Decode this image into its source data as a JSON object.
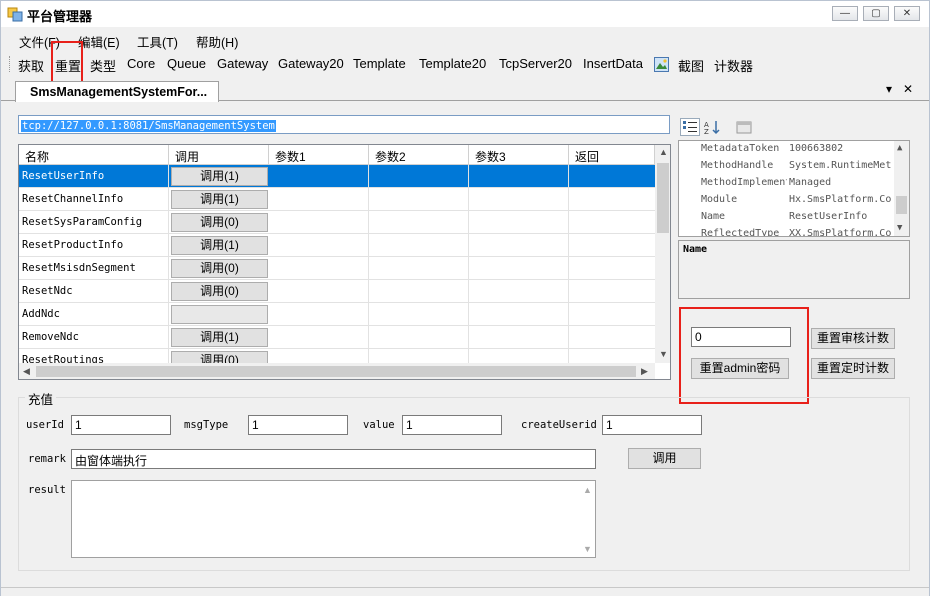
{
  "window": {
    "title": "平台管理器",
    "controls": {
      "minimize": "—",
      "maximize": "▢",
      "close": "✕"
    }
  },
  "menu": [
    "文件(F)",
    "编辑(E)",
    "工具(T)",
    "帮助(H)"
  ],
  "toolbar": [
    "获取",
    "重置",
    "类型",
    "Core",
    "Queue",
    "Gateway",
    "Gateway20",
    "Template",
    "Template20",
    "TcpServer20",
    "InsertData",
    "截图",
    "计数器"
  ],
  "tab": {
    "label": "SmsManagementSystemFor...",
    "dropdown": "▾",
    "close": "✕"
  },
  "url": "tcp://127.0.0.1:8081/SmsManagementSystem",
  "grid": {
    "columns": [
      "名称",
      "调用",
      "参数1",
      "参数2",
      "参数3",
      "返回"
    ],
    "rows": [
      {
        "name": "ResetUserInfo",
        "call": "调用(1)"
      },
      {
        "name": "ResetChannelInfo",
        "call": "调用(1)"
      },
      {
        "name": "ResetSysParamConfig",
        "call": "调用(0)"
      },
      {
        "name": "ResetProductInfo",
        "call": "调用(1)"
      },
      {
        "name": "ResetMsisdnSegment",
        "call": "调用(0)"
      },
      {
        "name": "ResetNdc",
        "call": "调用(0)"
      },
      {
        "name": "AddNdc",
        "call": ""
      },
      {
        "name": "RemoveNdc",
        "call": "调用(1)"
      },
      {
        "name": "ResetRoutings",
        "call": "调用(0)"
      }
    ],
    "selected_index": 0
  },
  "properties": {
    "rows": [
      {
        "key": "MetadataToken",
        "value": "100663802"
      },
      {
        "key": "MethodHandle",
        "value": "System.RuntimeMet"
      },
      {
        "key": "MethodImplementation",
        "value": "Managed"
      },
      {
        "key": "Module",
        "value": "Hx.SmsPlatform.Co"
      },
      {
        "key": "Name",
        "value": "ResetUserInfo"
      },
      {
        "key": "ReflectedType",
        "value": "XX.SmsPlatform.Co"
      }
    ],
    "description": "Name"
  },
  "counter": {
    "value": "0",
    "reset_audit_label": "重置审核计数",
    "reset_admin_label": "重置admin密码",
    "reset_timer_label": "重置定时计数"
  },
  "recharge": {
    "title": "充值",
    "userId_label": "userId",
    "userId_value": "1",
    "msgType_label": "msgType",
    "msgType_value": "1",
    "value_label": "value",
    "value_value": "1",
    "createUserid_label": "createUserid",
    "createUserid_value": "1",
    "remark_label": "remark",
    "remark_value": "由窗体端执行",
    "call_label": "调用",
    "result_label": "result"
  }
}
